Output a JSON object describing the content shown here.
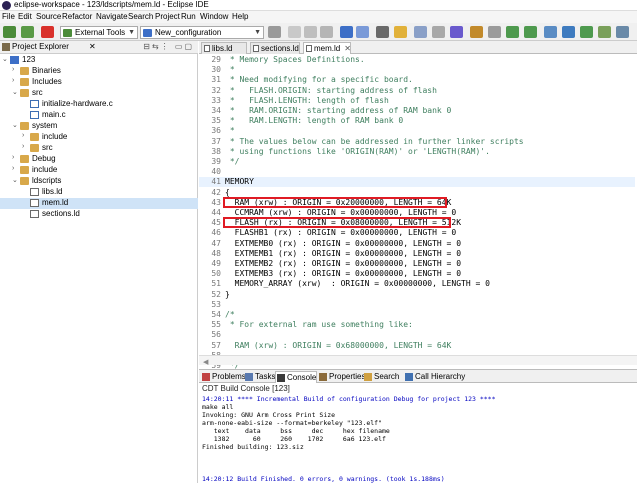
{
  "window": {
    "title": "eclipse-workspace - 123/ldscripts/mem.ld - Eclipse IDE"
  },
  "menu": [
    "File",
    "Edit",
    "Source",
    "Refactor",
    "Navigate",
    "Search",
    "Project",
    "Run",
    "Window",
    "Help"
  ],
  "toolbar": {
    "external_tools_label": "External Tools",
    "launch_config_label": "New_configuration"
  },
  "project_explorer": {
    "title": "Project Explorer",
    "items": [
      {
        "label": "123",
        "indent": 0,
        "expanded": true,
        "kind": "project"
      },
      {
        "label": "Binaries",
        "indent": 1,
        "expanded": false,
        "kind": "folder"
      },
      {
        "label": "Includes",
        "indent": 1,
        "expanded": false,
        "kind": "folder"
      },
      {
        "label": "src",
        "indent": 1,
        "expanded": true,
        "kind": "folder"
      },
      {
        "label": "initialize-hardware.c",
        "indent": 2,
        "expanded": false,
        "kind": "cfile"
      },
      {
        "label": "main.c",
        "indent": 2,
        "expanded": false,
        "kind": "cfile"
      },
      {
        "label": "system",
        "indent": 1,
        "expanded": true,
        "kind": "folder"
      },
      {
        "label": "include",
        "indent": 2,
        "expanded": false,
        "kind": "folder"
      },
      {
        "label": "src",
        "indent": 2,
        "expanded": false,
        "kind": "folder"
      },
      {
        "label": "Debug",
        "indent": 1,
        "expanded": false,
        "kind": "folder"
      },
      {
        "label": "include",
        "indent": 1,
        "expanded": false,
        "kind": "folder"
      },
      {
        "label": "ldscripts",
        "indent": 1,
        "expanded": true,
        "kind": "folder"
      },
      {
        "label": "libs.ld",
        "indent": 2,
        "expanded": false,
        "kind": "file"
      },
      {
        "label": "mem.ld",
        "indent": 2,
        "expanded": false,
        "kind": "file",
        "selected": true
      },
      {
        "label": "sections.ld",
        "indent": 2,
        "expanded": false,
        "kind": "file"
      }
    ]
  },
  "editor": {
    "tabs": [
      {
        "label": "libs.ld",
        "active": false
      },
      {
        "label": "sections.ld",
        "active": false
      },
      {
        "label": "mem.ld",
        "active": true
      }
    ],
    "lines": [
      {
        "num": "29",
        "text": " * Memory Spaces Definitions.",
        "comment": true
      },
      {
        "num": "30",
        "text": " *",
        "comment": true
      },
      {
        "num": "31",
        "text": " * Need modifying for a specific board.",
        "comment": true
      },
      {
        "num": "32",
        "text": " *   FLASH.ORIGIN: starting address of flash",
        "comment": true
      },
      {
        "num": "33",
        "text": " *   FLASH.LENGTH: length of flash",
        "comment": true
      },
      {
        "num": "34",
        "text": " *   RAM.ORIGIN: starting address of RAM bank 0",
        "comment": true
      },
      {
        "num": "35",
        "text": " *   RAM.LENGTH: length of RAM bank 0",
        "comment": true
      },
      {
        "num": "36",
        "text": " *",
        "comment": true
      },
      {
        "num": "37",
        "text": " * The values below can be addressed in further linker scripts",
        "comment": true
      },
      {
        "num": "38",
        "text": " * using functions like 'ORIGIN(RAM)' or 'LENGTH(RAM)'.",
        "comment": true
      },
      {
        "num": "39",
        "text": " */",
        "comment": true
      },
      {
        "num": "40",
        "text": "",
        "comment": false
      },
      {
        "num": "41",
        "text": "MEMORY",
        "comment": false
      },
      {
        "num": "42",
        "text": "{",
        "comment": false
      },
      {
        "num": "43",
        "text": "  RAM (xrw) : ORIGIN = 0x20000000, LENGTH = 64K",
        "comment": false
      },
      {
        "num": "44",
        "text": "  CCMRAM (xrw) : ORIGIN = 0x00000000, LENGTH = 0",
        "comment": false
      },
      {
        "num": "45",
        "text": "  FLASH (rx) : ORIGIN = 0x08000000, LENGTH = 512K",
        "comment": false
      },
      {
        "num": "46",
        "text": "  FLASHB1 (rx) : ORIGIN = 0x00000000, LENGTH = 0",
        "comment": false
      },
      {
        "num": "47",
        "text": "  EXTMEMB0 (rx) : ORIGIN = 0x00000000, LENGTH = 0",
        "comment": false
      },
      {
        "num": "48",
        "text": "  EXTMEMB1 (rx) : ORIGIN = 0x00000000, LENGTH = 0",
        "comment": false
      },
      {
        "num": "49",
        "text": "  EXTMEMB2 (rx) : ORIGIN = 0x00000000, LENGTH = 0",
        "comment": false
      },
      {
        "num": "50",
        "text": "  EXTMEMB3 (rx) : ORIGIN = 0x00000000, LENGTH = 0",
        "comment": false
      },
      {
        "num": "51",
        "text": "  MEMORY_ARRAY (xrw)  : ORIGIN = 0x00000000, LENGTH = 0",
        "comment": false
      },
      {
        "num": "52",
        "text": "}",
        "comment": false
      },
      {
        "num": "53",
        "text": "",
        "comment": false
      },
      {
        "num": "54",
        "text": "/*",
        "comment": true
      },
      {
        "num": "55",
        "text": " * For external ram use something like:",
        "comment": true
      },
      {
        "num": "56",
        "text": "",
        "comment": true
      },
      {
        "num": "57",
        "text": "  RAM (xrw) : ORIGIN = 0x68000000, LENGTH = 64K",
        "comment": true
      },
      {
        "num": "58",
        "text": "",
        "comment": true
      },
      {
        "num": "59",
        "text": " */",
        "comment": true
      },
      {
        "num": "60",
        "text": "",
        "comment": false
      }
    ]
  },
  "bottom_panel": {
    "tabs": [
      "Problems",
      "Tasks",
      "Console",
      "Properties",
      "Search",
      "Call Hierarchy"
    ],
    "active_tab": "Console",
    "console_title": "CDT Build Console [123]",
    "console_lines": [
      {
        "text": "14:20:11 **** Incremental Build of configuration Debug for project 123 ****",
        "blue": true
      },
      {
        "text": "make all",
        "blue": false
      },
      {
        "text": "Invoking: GNU Arm Cross Print Size",
        "blue": false
      },
      {
        "text": "arm-none-eabi-size --format=berkeley \"123.elf\"",
        "blue": false
      },
      {
        "text": "   text    data     bss     dec     hex filename",
        "blue": false
      },
      {
        "text": "   1382      60     260    1702     6a6 123.elf",
        "blue": false
      },
      {
        "text": "Finished building: 123.siz",
        "blue": false
      },
      {
        "text": "",
        "blue": false
      },
      {
        "text": "",
        "blue": false
      },
      {
        "text": "",
        "blue": false
      },
      {
        "text": "14:20:12 Build Finished. 0 errors, 0 warnings. (took 1s.188ms)",
        "blue": true
      }
    ]
  },
  "colors": {
    "comment": "#3f7f5f",
    "highlight_box": "#e01b24",
    "console_blue": "#0000c0",
    "selection": "#cfe3f7"
  }
}
